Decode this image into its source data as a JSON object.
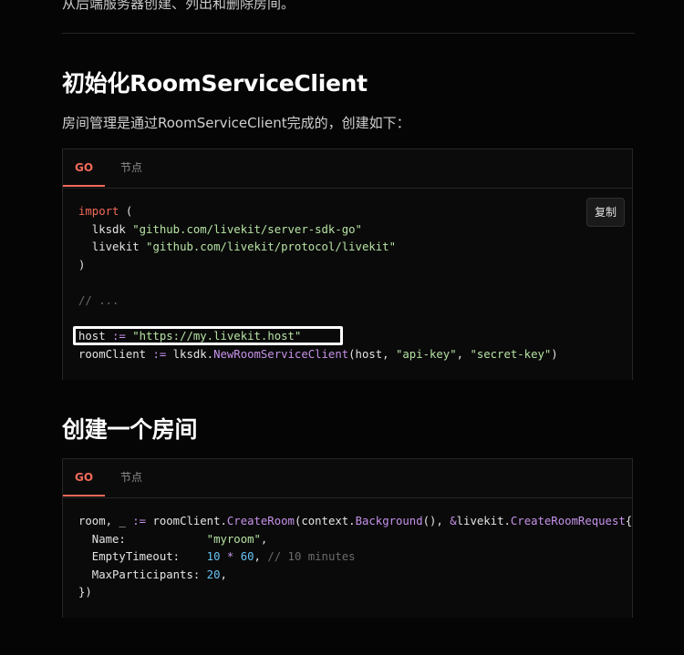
{
  "intro": {
    "text": "从后端服务器创建、列出和删除房间。"
  },
  "section1": {
    "title": "初始化RoomServiceClient",
    "description": "房间管理是通过RoomServiceClient完成的，创建如下："
  },
  "section2": {
    "title": "创建一个房间"
  },
  "code_block_1": {
    "tabs": [
      "GO",
      "节点"
    ],
    "copy_label": "复制"
  },
  "code_block_2": {
    "tabs": [
      "GO",
      "节点"
    ]
  },
  "code1": {
    "l1_kw": "import",
    "l1_rest": " (",
    "l2_a": "  lksdk ",
    "l2_s": "\"github.com/livekit/server-sdk-go\"",
    "l3_a": "  livekit ",
    "l3_s": "\"github.com/livekit/protocol/livekit\"",
    "l4": ")",
    "l6": "// ...",
    "l8_a": "host ",
    "l8_op": ":=",
    "l8_sp": " ",
    "l8_s": "\"https://my.livekit.host\"",
    "l9_a": "roomClient ",
    "l9_op": ":=",
    "l9_b": " lksdk.",
    "l9_fn": "NewRoomServiceClient",
    "l9_c": "(host, ",
    "l9_s1": "\"api-key\"",
    "l9_d": ", ",
    "l9_s2": "\"secret-key\"",
    "l9_e": ")"
  },
  "code2": {
    "l1_a": "room, _ ",
    "l1_op": ":=",
    "l1_b": " roomClient.",
    "l1_fn": "CreateRoom",
    "l1_c": "(context.",
    "l1_fn2": "Background",
    "l1_d": "(), ",
    "l1_amp": "&",
    "l1_e": "livekit.",
    "l1_fn3": "CreateRoomRequest",
    "l1_f": "{",
    "l2_a": "  Name:            ",
    "l2_s": "\"myroom\"",
    "l2_b": ",",
    "l3_a": "  EmptyTimeout:    ",
    "l3_n1": "10",
    "l3_op": " * ",
    "l3_n2": "60",
    "l3_b": ", ",
    "l3_cm": "// 10 minutes",
    "l4_a": "  MaxParticipants: ",
    "l4_n": "20",
    "l4_b": ",",
    "l5": "})"
  }
}
